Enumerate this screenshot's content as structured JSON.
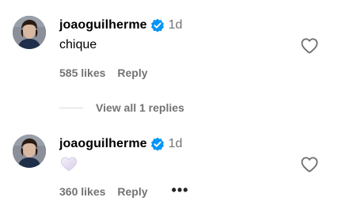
{
  "comments": [
    {
      "username": "joaoguilherme",
      "time": "1d",
      "text": "chique",
      "likes": "585 likes",
      "reply_label": "Reply"
    },
    {
      "username": "joaoguilherme",
      "time": "1d",
      "emoji": "white-heart",
      "likes": "360 likes",
      "reply_label": "Reply",
      "more_label": "•••"
    }
  ],
  "view_replies": {
    "label": "View all 1 replies"
  },
  "icons": {
    "verified": "verified-badge-icon",
    "like": "heart-outline-icon",
    "reaction": "white-heart-emoji",
    "more": "more-options-icon"
  },
  "colors": {
    "verified_blue": "#0095f6",
    "secondary_text": "#737373",
    "divider": "#dbdbdb"
  }
}
